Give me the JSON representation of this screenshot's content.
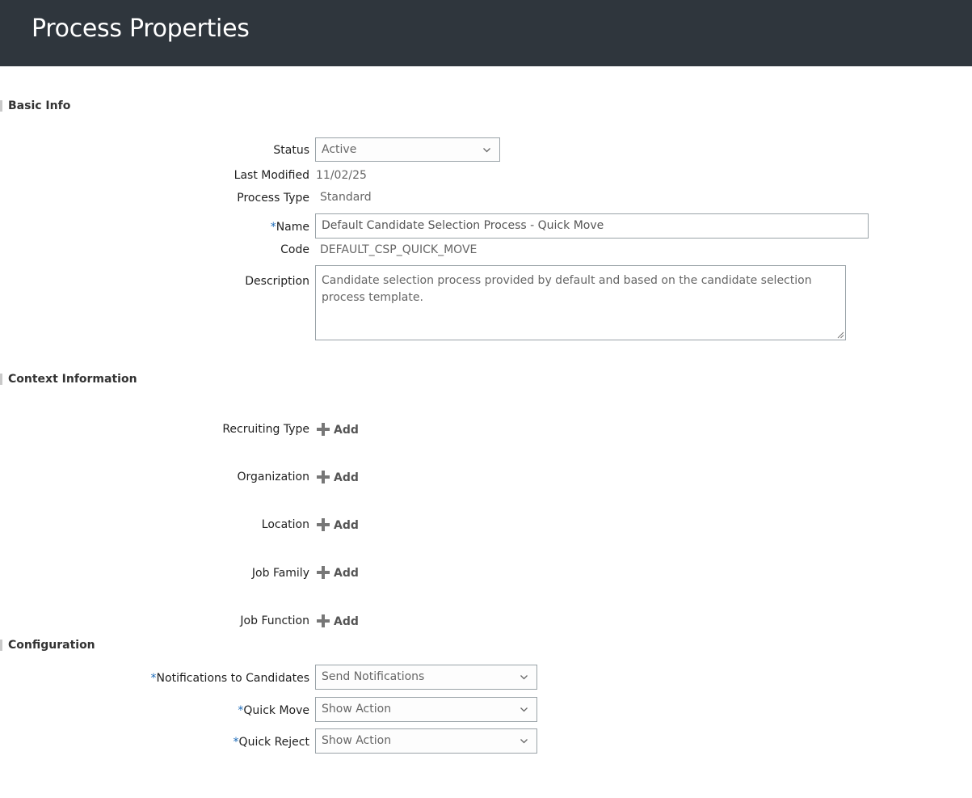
{
  "header": {
    "title": "Process Properties"
  },
  "sections": {
    "basic_info": "Basic Info",
    "context_information": "Context Information",
    "configuration": "Configuration"
  },
  "basic": {
    "status_label": "Status",
    "status_value": "Active",
    "last_modified_label": "Last Modified",
    "last_modified_value": "11/02/25",
    "process_type_label": "Process Type",
    "process_type_value": "Standard",
    "name_label": "Name",
    "name_value": "Default Candidate Selection Process - Quick Move",
    "code_label": "Code",
    "code_value": "DEFAULT_CSP_QUICK_MOVE",
    "description_label": "Description",
    "description_value": "Candidate selection process provided by default and based on the candidate selection process template."
  },
  "context": {
    "add_label": "Add",
    "recruiting_type_label": "Recruiting Type",
    "organization_label": "Organization",
    "location_label": "Location",
    "job_family_label": "Job Family",
    "job_function_label": "Job Function"
  },
  "configuration": {
    "notifications_label": "Notifications to Candidates",
    "notifications_value": "Send Notifications",
    "quick_move_label": "Quick Move",
    "quick_move_value": "Show Action",
    "quick_reject_label": "Quick Reject",
    "quick_reject_value": "Show Action"
  },
  "required_marker": "*",
  "colors": {
    "header_bg": "#2f363d",
    "required": "#1d6bb8",
    "border": "#9aa3a8"
  }
}
